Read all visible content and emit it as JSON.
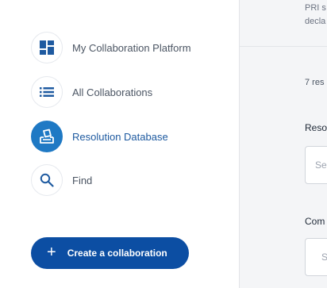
{
  "sidebar": {
    "items": [
      {
        "label": "My Collaboration Platform",
        "icon": "dashboard-icon"
      },
      {
        "label": "All Collaborations",
        "icon": "list-icon"
      },
      {
        "label": "Resolution Database",
        "icon": "ballot-box-icon",
        "active": true
      },
      {
        "label": "Find",
        "icon": "search-icon"
      }
    ],
    "create_button": {
      "label": "Create a collaboration",
      "icon": "plus-icon"
    }
  },
  "main": {
    "description_line1": "PRI s",
    "description_line2": "decla",
    "results_count": "7 res",
    "resolution_label": "Reso",
    "resolution_select_placeholder": "Se",
    "company_label": "Com",
    "company_select_placeholder": "S"
  },
  "colors": {
    "accent": "#1f79c4",
    "button": "#0c4ea3",
    "active_text": "#1e5aa0",
    "icon": "#1e5aa0"
  }
}
